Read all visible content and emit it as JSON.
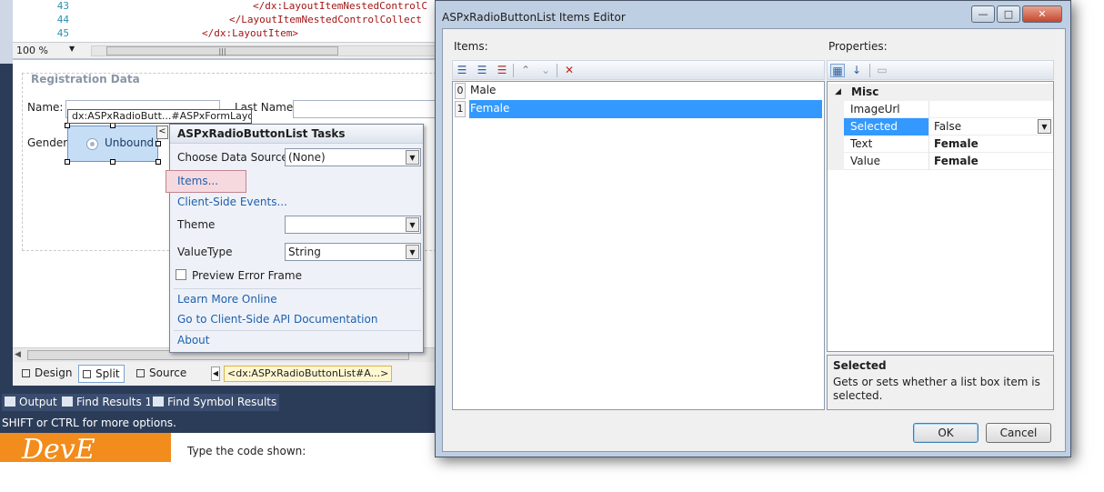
{
  "ide": {
    "code_lines": [
      {
        "num": "43",
        "text": "</dx:LayoutItemNestedControlC"
      },
      {
        "num": "44",
        "text": "</LayoutItemNestedControlCollect"
      },
      {
        "num": "45",
        "text": "</dx:LayoutItem>"
      }
    ],
    "zoom": "100 %",
    "design": {
      "group_title": "Registration Data",
      "name_label": "Name:",
      "last_name_label": "Last Name:",
      "gender_label": "Gender:",
      "control_tag": "dx:ASPxRadioButt...#ASPxFormLayou...",
      "radio_text": "Unbound",
      "smart_tag_glyph": "<"
    },
    "view_tabs": {
      "design": "Design",
      "split": "Split",
      "source": "Source"
    },
    "tag_path": "<dx:ASPxRadioButtonList#A...>",
    "bottom_tabs": [
      "Output",
      "Find Results 1",
      "Find Symbol Results"
    ],
    "status": "SHIFT or CTRL for more options.",
    "logo_text": "DevE",
    "captcha_text": "Type the code shown:"
  },
  "tasks": {
    "title": "ASPxRadioButtonList Tasks",
    "choose_ds_label": "Choose Data Source:",
    "choose_ds_value": "(None)",
    "items_link": "Items...",
    "client_events_link": "Client-Side Events...",
    "theme_label": "Theme",
    "theme_value": "",
    "value_type_label": "ValueType",
    "value_type_value": "String",
    "preview_label": "Preview Error Frame",
    "learn_more": "Learn More Online",
    "api_docs": "Go to Client-Side API Documentation",
    "about": "About"
  },
  "dialog": {
    "title": "ASPxRadioButtonList Items Editor",
    "items_label": "Items:",
    "items": [
      {
        "index": "0",
        "text": "Male",
        "selected": false
      },
      {
        "index": "1",
        "text": "Female",
        "selected": true
      }
    ],
    "properties_label": "Properties:",
    "category": "Misc",
    "properties": [
      {
        "name": "ImageUrl",
        "value": ""
      },
      {
        "name": "Selected",
        "value": "False"
      },
      {
        "name": "Text",
        "value": "Female"
      },
      {
        "name": "Value",
        "value": "Female"
      }
    ],
    "description_title": "Selected",
    "description_text": "Gets or sets whether a list box item is selected.",
    "ok": "OK",
    "cancel": "Cancel"
  },
  "colors": {
    "selection": "#3399ff",
    "ide_dark": "#2b3c59",
    "link": "#1f5fae",
    "logo": "#f28c1c"
  }
}
